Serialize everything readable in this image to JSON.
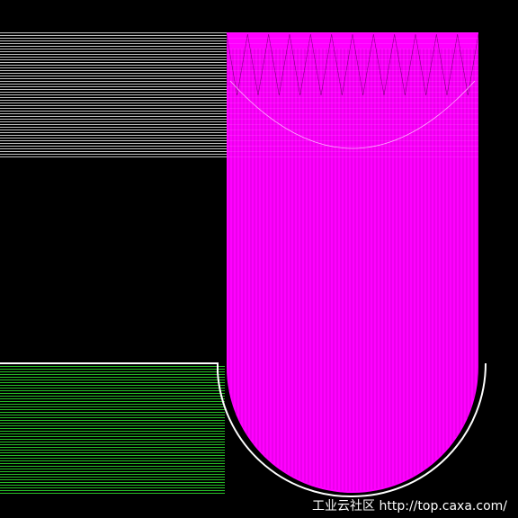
{
  "watermark": {
    "label": "工业云社区",
    "url": "http://top.caxa.com/"
  },
  "colors": {
    "background": "#000000",
    "upper_hatch": "#ffffff",
    "lower_hatch": "#33ff33",
    "toolpath": "#ff00ff",
    "outline": "#ffffff"
  }
}
